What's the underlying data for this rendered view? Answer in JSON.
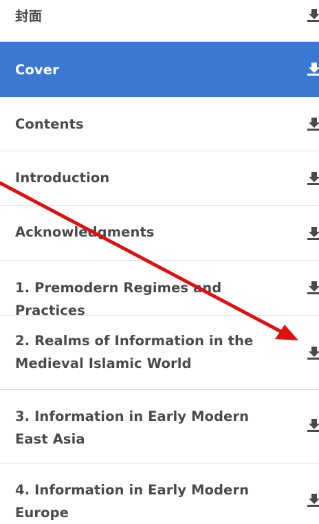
{
  "toc": {
    "items": [
      {
        "label": "封面",
        "icon": "download-icon"
      },
      {
        "label": "Cover",
        "icon": "download-icon",
        "selected": true
      },
      {
        "label": "Contents",
        "icon": "download-icon"
      },
      {
        "label": "Introduction",
        "icon": "download-icon"
      },
      {
        "label": "Acknowledgments",
        "icon": "download-icon"
      },
      {
        "label": "1. Premodern Regimes and Practices",
        "icon": "download-icon"
      },
      {
        "label": "2. Realms of Information in the Medieval Islamic World",
        "icon": "download-icon"
      },
      {
        "label": "3. Information in Early Modern East Asia",
        "icon": "download-icon"
      },
      {
        "label": "4. Information in Early Modern Europe",
        "icon": "download-icon"
      }
    ]
  },
  "colors": {
    "selected_background": "#3a78d1",
    "text": "#4a4a4a",
    "divider": "#dddddd",
    "annotation_arrow": "#e01010"
  }
}
